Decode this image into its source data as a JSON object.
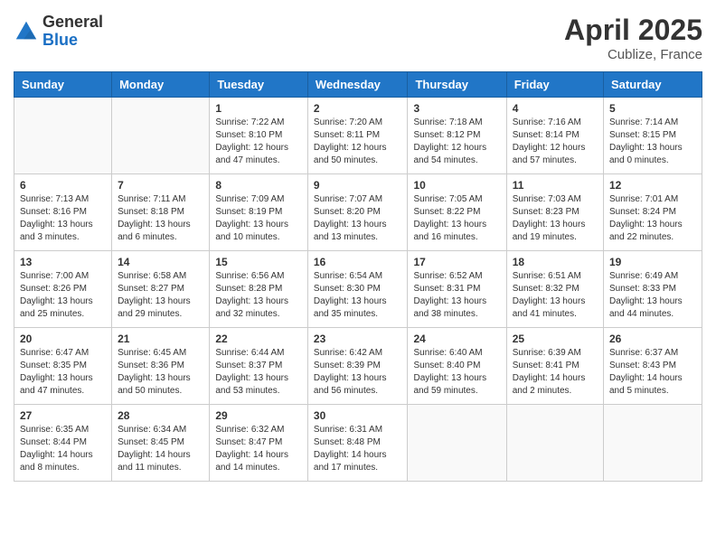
{
  "header": {
    "logo_general": "General",
    "logo_blue": "Blue",
    "month_title": "April 2025",
    "location": "Cublize, France"
  },
  "days_of_week": [
    "Sunday",
    "Monday",
    "Tuesday",
    "Wednesday",
    "Thursday",
    "Friday",
    "Saturday"
  ],
  "weeks": [
    [
      {
        "day": "",
        "info": ""
      },
      {
        "day": "",
        "info": ""
      },
      {
        "day": "1",
        "info": "Sunrise: 7:22 AM\nSunset: 8:10 PM\nDaylight: 12 hours and 47 minutes."
      },
      {
        "day": "2",
        "info": "Sunrise: 7:20 AM\nSunset: 8:11 PM\nDaylight: 12 hours and 50 minutes."
      },
      {
        "day": "3",
        "info": "Sunrise: 7:18 AM\nSunset: 8:12 PM\nDaylight: 12 hours and 54 minutes."
      },
      {
        "day": "4",
        "info": "Sunrise: 7:16 AM\nSunset: 8:14 PM\nDaylight: 12 hours and 57 minutes."
      },
      {
        "day": "5",
        "info": "Sunrise: 7:14 AM\nSunset: 8:15 PM\nDaylight: 13 hours and 0 minutes."
      }
    ],
    [
      {
        "day": "6",
        "info": "Sunrise: 7:13 AM\nSunset: 8:16 PM\nDaylight: 13 hours and 3 minutes."
      },
      {
        "day": "7",
        "info": "Sunrise: 7:11 AM\nSunset: 8:18 PM\nDaylight: 13 hours and 6 minutes."
      },
      {
        "day": "8",
        "info": "Sunrise: 7:09 AM\nSunset: 8:19 PM\nDaylight: 13 hours and 10 minutes."
      },
      {
        "day": "9",
        "info": "Sunrise: 7:07 AM\nSunset: 8:20 PM\nDaylight: 13 hours and 13 minutes."
      },
      {
        "day": "10",
        "info": "Sunrise: 7:05 AM\nSunset: 8:22 PM\nDaylight: 13 hours and 16 minutes."
      },
      {
        "day": "11",
        "info": "Sunrise: 7:03 AM\nSunset: 8:23 PM\nDaylight: 13 hours and 19 minutes."
      },
      {
        "day": "12",
        "info": "Sunrise: 7:01 AM\nSunset: 8:24 PM\nDaylight: 13 hours and 22 minutes."
      }
    ],
    [
      {
        "day": "13",
        "info": "Sunrise: 7:00 AM\nSunset: 8:26 PM\nDaylight: 13 hours and 25 minutes."
      },
      {
        "day": "14",
        "info": "Sunrise: 6:58 AM\nSunset: 8:27 PM\nDaylight: 13 hours and 29 minutes."
      },
      {
        "day": "15",
        "info": "Sunrise: 6:56 AM\nSunset: 8:28 PM\nDaylight: 13 hours and 32 minutes."
      },
      {
        "day": "16",
        "info": "Sunrise: 6:54 AM\nSunset: 8:30 PM\nDaylight: 13 hours and 35 minutes."
      },
      {
        "day": "17",
        "info": "Sunrise: 6:52 AM\nSunset: 8:31 PM\nDaylight: 13 hours and 38 minutes."
      },
      {
        "day": "18",
        "info": "Sunrise: 6:51 AM\nSunset: 8:32 PM\nDaylight: 13 hours and 41 minutes."
      },
      {
        "day": "19",
        "info": "Sunrise: 6:49 AM\nSunset: 8:33 PM\nDaylight: 13 hours and 44 minutes."
      }
    ],
    [
      {
        "day": "20",
        "info": "Sunrise: 6:47 AM\nSunset: 8:35 PM\nDaylight: 13 hours and 47 minutes."
      },
      {
        "day": "21",
        "info": "Sunrise: 6:45 AM\nSunset: 8:36 PM\nDaylight: 13 hours and 50 minutes."
      },
      {
        "day": "22",
        "info": "Sunrise: 6:44 AM\nSunset: 8:37 PM\nDaylight: 13 hours and 53 minutes."
      },
      {
        "day": "23",
        "info": "Sunrise: 6:42 AM\nSunset: 8:39 PM\nDaylight: 13 hours and 56 minutes."
      },
      {
        "day": "24",
        "info": "Sunrise: 6:40 AM\nSunset: 8:40 PM\nDaylight: 13 hours and 59 minutes."
      },
      {
        "day": "25",
        "info": "Sunrise: 6:39 AM\nSunset: 8:41 PM\nDaylight: 14 hours and 2 minutes."
      },
      {
        "day": "26",
        "info": "Sunrise: 6:37 AM\nSunset: 8:43 PM\nDaylight: 14 hours and 5 minutes."
      }
    ],
    [
      {
        "day": "27",
        "info": "Sunrise: 6:35 AM\nSunset: 8:44 PM\nDaylight: 14 hours and 8 minutes."
      },
      {
        "day": "28",
        "info": "Sunrise: 6:34 AM\nSunset: 8:45 PM\nDaylight: 14 hours and 11 minutes."
      },
      {
        "day": "29",
        "info": "Sunrise: 6:32 AM\nSunset: 8:47 PM\nDaylight: 14 hours and 14 minutes."
      },
      {
        "day": "30",
        "info": "Sunrise: 6:31 AM\nSunset: 8:48 PM\nDaylight: 14 hours and 17 minutes."
      },
      {
        "day": "",
        "info": ""
      },
      {
        "day": "",
        "info": ""
      },
      {
        "day": "",
        "info": ""
      }
    ]
  ]
}
